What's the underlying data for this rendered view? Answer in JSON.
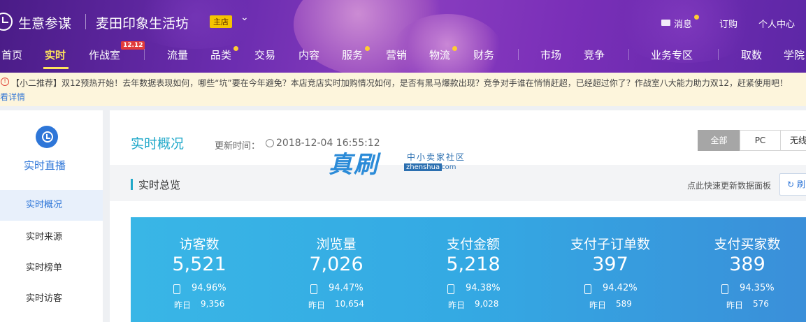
{
  "header": {
    "brand": "生意参谋",
    "shop_name": "麦田印象生活坊",
    "shop_badge": "主店",
    "chevron_glyph": "⌄",
    "messages": "消息",
    "subscribe": "订购",
    "personal_center": "个人中心",
    "nav": {
      "home": "首页",
      "realtime": "实时",
      "war_room": "作战室",
      "war_room_badge": "12.12",
      "traffic": "流量",
      "category": "品类",
      "trade": "交易",
      "content": "内容",
      "service": "服务",
      "marketing": "营销",
      "logistics": "物流",
      "finance": "财务",
      "market": "市场",
      "competition": "竞争",
      "business_zone": "业务专区",
      "fetch": "取数",
      "academy": "学院"
    }
  },
  "notice": {
    "icon": "!",
    "text": "【小二推荐】双12预热开始！去年数据表现如何，哪些“坑”要在今年避免？本店竞店实时加购情况如何，是否有黑马爆款出现？竞争对手谁在悄悄赶超，已经超过你了？作战室八大能力助力双12，赶紧使用吧！",
    "link": "看详情"
  },
  "sidebar": {
    "title": "实时直播",
    "items": [
      "实时概况",
      "实时来源",
      "实时榜单",
      "实时访客"
    ]
  },
  "main": {
    "title": "实时概况",
    "update_label": "更新时间：",
    "update_time": "2018-12-04 16:55:12",
    "segments": [
      "全部",
      "PC",
      "无线"
    ],
    "section_title": "实时总览",
    "hint": "点此快速更新数据面板",
    "refresh_label": "刷",
    "refresh_icon": "↻",
    "stats": [
      {
        "label": "访客数",
        "value": "5,521",
        "pct": "94.96%",
        "yesterday_label": "昨日",
        "yesterday": "9,356"
      },
      {
        "label": "浏览量",
        "value": "7,026",
        "pct": "94.47%",
        "yesterday_label": "昨日",
        "yesterday": "10,654"
      },
      {
        "label": "支付金额",
        "value": "5,218",
        "pct": "94.38%",
        "yesterday_label": "昨日",
        "yesterday": "9,028"
      },
      {
        "label": "支付子订单数",
        "value": "397",
        "pct": "94.42%",
        "yesterday_label": "昨日",
        "yesterday": "589"
      },
      {
        "label": "支付买家数",
        "value": "389",
        "pct": "94.35%",
        "yesterday_label": "昨日",
        "yesterday": "576"
      }
    ]
  },
  "watermark": {
    "big": "真刷",
    "small": "中小卖家社区",
    "domain": "zhenshua",
    "tld": ".com"
  },
  "colors": {
    "header_purple": "#6c2db0",
    "nav_active": "#ffe45c",
    "accent_teal": "#1fa8c9",
    "accent_blue": "#2e76d8",
    "stats_blue": "#34a9e3"
  }
}
